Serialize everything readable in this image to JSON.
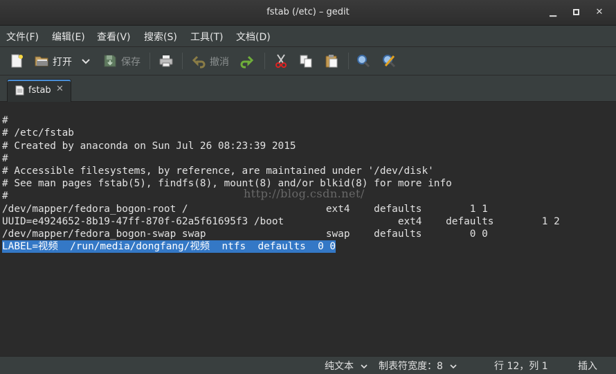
{
  "window": {
    "title": "fstab (/etc) – gedit",
    "minimize": "▁",
    "maximize": "▫",
    "close": "✕"
  },
  "menu": [
    "文件(F)",
    "编辑(E)",
    "查看(V)",
    "搜索(S)",
    "工具(T)",
    "文档(D)"
  ],
  "toolbar": {
    "open_label": "打开",
    "save_label": "保存",
    "undo_label": "撤消"
  },
  "tab": {
    "label": "fstab",
    "close": "✕"
  },
  "editor": {
    "lines": [
      "",
      "#",
      "# /etc/fstab",
      "# Created by anaconda on Sun Jul 26 08:23:39 2015",
      "#",
      "# Accessible filesystems, by reference, are maintained under '/dev/disk'",
      "# See man pages fstab(5), findfs(8), mount(8) and/or blkid(8) for more info",
      "#",
      "/dev/mapper/fedora_bogon-root /                       ext4    defaults        1 1",
      "UUID=e4924652-8b19-47ff-870f-62a5f61695f3 /boot                   ext4    defaults        1 2",
      "/dev/mapper/fedora_bogon-swap swap                    swap    defaults        0 0",
      "LABEL=视频  /run/media/dongfang/视频  ntfs  defaults  0 0"
    ],
    "selected_line_index": 11,
    "watermark": "http://blog.csdn.net/"
  },
  "status": {
    "language": "纯文本",
    "tab_width": "制表符宽度：8",
    "position": "行 12，列 1",
    "mode": "插入"
  },
  "colors": {
    "background": "#2b2b2b",
    "chrome": "#393f3f",
    "selection": "#3478c6"
  }
}
